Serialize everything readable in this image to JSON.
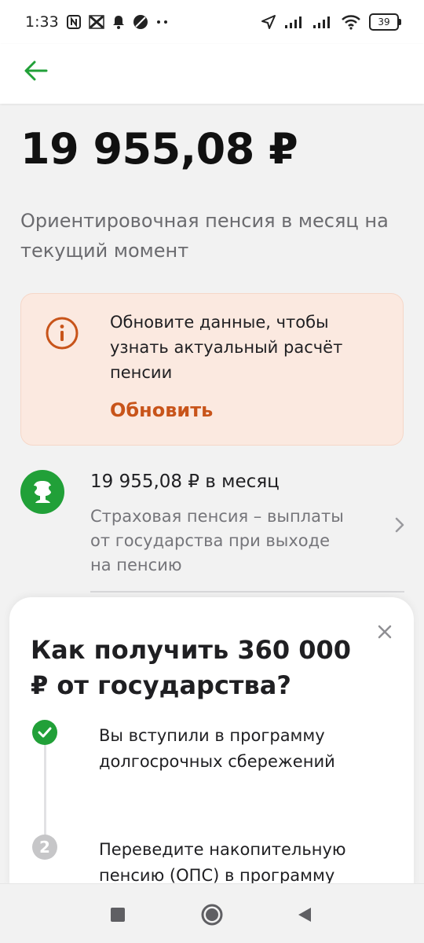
{
  "status_bar": {
    "time": "1:33",
    "battery": "39",
    "icons": [
      "nfc-icon",
      "x-app-icon",
      "bell-icon",
      "dnd-icon",
      "more-dots-icon",
      "location-arrow-icon",
      "signal-icon",
      "signal-icon",
      "wifi-icon",
      "battery-icon"
    ]
  },
  "header": {
    "back_icon": "arrow-left-icon"
  },
  "pension": {
    "amount": "19 955,08 ₽",
    "subtitle": "Ориентировочная пенсия в месяц на текущий момент"
  },
  "update_card": {
    "icon": "info-icon",
    "text": "Обновите данные, чтобы узнать актуальный расчёт пенсии",
    "link_label": "Обновить"
  },
  "insurance_pension": {
    "logo_icon": "sfr-logo-icon",
    "amount": "19 955,08 ₽ в месяц",
    "description": "Страховая пенсия – выплаты от государства при выходе на пенсию",
    "chevron_icon": "chevron-right-icon"
  },
  "sheet": {
    "title": "Как получить 360 000 ₽ от государства?",
    "close_icon": "close-icon",
    "steps": [
      {
        "marker": "check",
        "text": "Вы вступили в программу долгосрочных сбережений"
      },
      {
        "marker": "2",
        "text": "Переведите накопительную пенсию (ОПС) в программу"
      }
    ]
  },
  "colors": {
    "brand_green": "#21a038",
    "accent_orange": "#c8541a",
    "card_bg": "#fbe9e0"
  }
}
